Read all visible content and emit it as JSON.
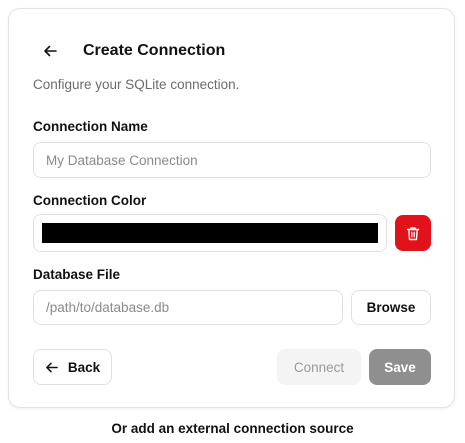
{
  "header": {
    "back_icon": "arrow-left-icon",
    "title": "Create Connection"
  },
  "subtitle": "Configure your SQLite connection.",
  "connection_name": {
    "label": "Connection Name",
    "value": "",
    "placeholder": "My Database Connection"
  },
  "connection_color": {
    "label": "Connection Color",
    "value": "#000000",
    "delete_icon": "trash-icon",
    "delete_color": "#e1121a"
  },
  "database_file": {
    "label": "Database File",
    "value": "",
    "placeholder": "/path/to/database.db",
    "browse_label": "Browse"
  },
  "actions": {
    "back_label": "Back",
    "back_icon": "arrow-left-icon",
    "connect_label": "Connect",
    "save_label": "Save"
  },
  "footer": {
    "text": "Or add an external connection source"
  }
}
